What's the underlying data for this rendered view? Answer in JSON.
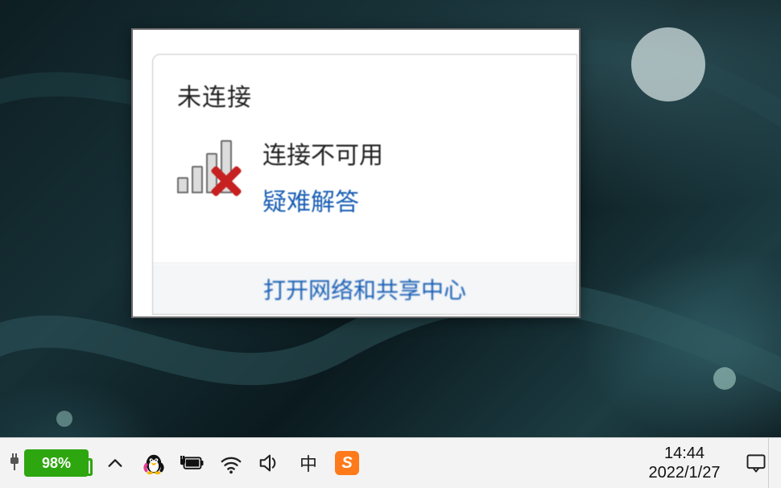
{
  "network_popup": {
    "title": "未连接",
    "status": "连接不可用",
    "troubleshoot": "疑难解答",
    "open_center": "打开网络和共享中心"
  },
  "taskbar": {
    "battery_percent": "98%",
    "ime_indicator": "中",
    "sogou_letter": "S",
    "time": "14:44",
    "date": "2022/1/27"
  }
}
